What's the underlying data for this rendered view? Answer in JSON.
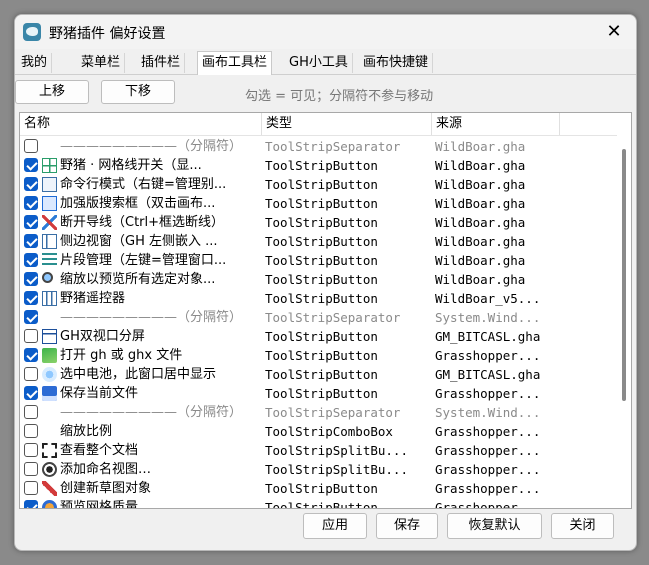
{
  "window": {
    "title": "野猪插件 偏好设置",
    "close_glyph": "✕"
  },
  "tabs": [
    {
      "label": "我的"
    },
    {
      "label": "菜单栏"
    },
    {
      "label": "插件栏"
    },
    {
      "label": "画布工具栏"
    },
    {
      "label": "GH小工具"
    },
    {
      "label": "画布快捷键"
    }
  ],
  "active_tab": "画布工具栏",
  "toolbar": {
    "move_up": "上移",
    "move_down": "下移",
    "hint": "勾选 = 可见；分隔符不参与移动"
  },
  "columns": {
    "name": "名称",
    "type": "类型",
    "source": "来源"
  },
  "rows": [
    {
      "checked": false,
      "icon": "none",
      "name": "—————————（分隔符）",
      "type": "ToolStripSeparator",
      "source": "WildBoar.gha",
      "sep": true
    },
    {
      "checked": true,
      "icon": "grid-icon",
      "name": "野猪 · 网格线开关（显...",
      "type": "ToolStripButton",
      "source": "WildBoar.gha",
      "sep": false
    },
    {
      "checked": true,
      "icon": "terminal-icon",
      "name": "命令行模式（右键=管理别...",
      "type": "ToolStripButton",
      "source": "WildBoar.gha",
      "sep": false
    },
    {
      "checked": true,
      "icon": "search-box-icon",
      "name": "加强版搜索框（双击画布...",
      "type": "ToolStripButton",
      "source": "WildBoar.gha",
      "sep": false
    },
    {
      "checked": true,
      "icon": "cut-wire-icon",
      "name": "断开导线（Ctrl+框选断线）",
      "type": "ToolStripButton",
      "source": "WildBoar.gha",
      "sep": false
    },
    {
      "checked": true,
      "icon": "sidebar-view-icon",
      "name": "侧边视窗（GH 左侧嵌入 ...",
      "type": "ToolStripButton",
      "source": "WildBoar.gha",
      "sep": false
    },
    {
      "checked": true,
      "icon": "snippet-icon",
      "name": "片段管理（左键=管理窗口...",
      "type": "ToolStripButton",
      "source": "WildBoar.gha",
      "sep": false
    },
    {
      "checked": true,
      "icon": "zoom-preview-icon",
      "name": "缩放以预览所有选定对象...",
      "type": "ToolStripButton",
      "source": "WildBoar.gha",
      "sep": false
    },
    {
      "checked": true,
      "icon": "remote-control-icon",
      "name": "野猪遥控器",
      "type": "ToolStripButton",
      "source": "WildBoar_v5...",
      "sep": false
    },
    {
      "checked": true,
      "icon": "none",
      "name": "—————————（分隔符）",
      "type": "ToolStripSeparator",
      "source": "System.Wind...",
      "sep": true
    },
    {
      "checked": false,
      "icon": "dual-viewport-icon",
      "name": "GH双视口分屏",
      "type": "ToolStripButton",
      "source": "GM_BITCASL.gha",
      "sep": false
    },
    {
      "checked": true,
      "icon": "open-folder-icon",
      "name": "打开 gh 或 ghx 文件",
      "type": "ToolStripButton",
      "source": "Grasshopper...",
      "sep": false
    },
    {
      "checked": false,
      "icon": "battery-icon",
      "name": "选中电池，此窗口居中显示",
      "type": "ToolStripButton",
      "source": "GM_BITCASL.gha",
      "sep": false
    },
    {
      "checked": true,
      "icon": "save-icon",
      "name": "保存当前文件",
      "type": "ToolStripButton",
      "source": "Grasshopper...",
      "sep": false
    },
    {
      "checked": false,
      "icon": "none",
      "name": "—————————（分隔符）",
      "type": "ToolStripSeparator",
      "source": "System.Wind...",
      "sep": true
    },
    {
      "checked": false,
      "icon": "none",
      "name": "缩放比例",
      "type": "ToolStripComboBox",
      "source": "Grasshopper...",
      "sep": false
    },
    {
      "checked": false,
      "icon": "zoom-extents-icon",
      "name": "查看整个文档",
      "type": "ToolStripSplitBu...",
      "source": "Grasshopper...",
      "sep": false
    },
    {
      "checked": false,
      "icon": "eye-icon",
      "name": "添加命名视图…",
      "type": "ToolStripSplitBu...",
      "source": "Grasshopper...",
      "sep": false
    },
    {
      "checked": false,
      "icon": "sketch-icon",
      "name": "创建新草图对象",
      "type": "ToolStripButton",
      "source": "Grasshopper...",
      "sep": false
    },
    {
      "checked": true,
      "icon": "preview-quality-icon",
      "name": "预览网格质量",
      "type": "ToolStripButton",
      "source": "Grasshopper...",
      "sep": false
    }
  ],
  "buttons": {
    "apply": "应用",
    "save": "保存",
    "reset": "恢复默认",
    "close": "关闭"
  },
  "colors": {
    "accent": "#0b5cc9",
    "separator_text": "#8a8a8a"
  }
}
